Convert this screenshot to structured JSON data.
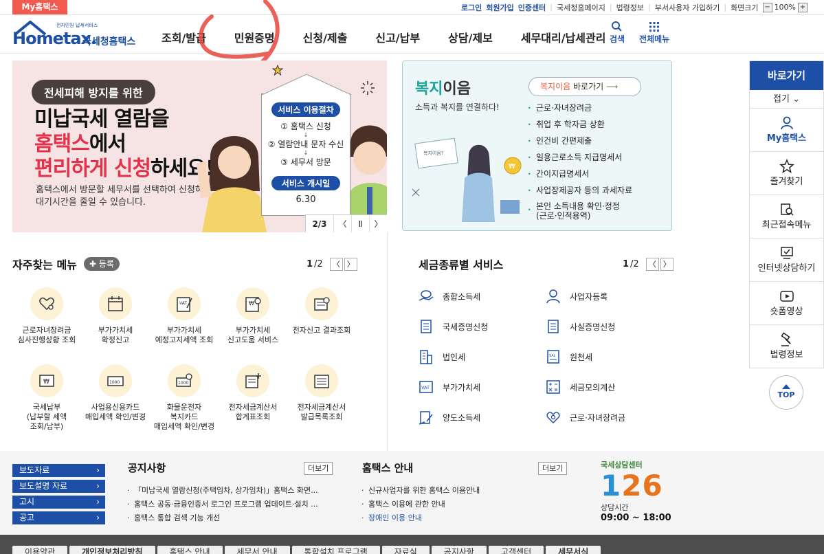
{
  "topbar": {
    "my_hometax": "My홈택스",
    "utils": [
      "로그인",
      "회원가입",
      "인증센터",
      "국세청홈페이지",
      "법령정보",
      "부서사용자 가입하기",
      "화면크기"
    ],
    "zoom": "100%"
  },
  "header": {
    "logo_word": "Hometax.",
    "logo_small": "전자민원 납세서비스",
    "logo_kr": "국세청홈택스",
    "nav": [
      "조회/발급",
      "민원증명",
      "신청/제출",
      "신고/납부",
      "상담/제보",
      "세무대리/납세관리"
    ],
    "search_label": "검색",
    "menu_label": "전체메뉴"
  },
  "hero": {
    "pill": "전세피해 방지를 위한",
    "line1": "미납국세 열람을",
    "line2_red": "홈택스",
    "line2_rest": "에서",
    "line3_red": "편리하게 신청",
    "line3_rest": "하세요!",
    "sub1": "홈택스에서 방문할 세무서를 선택하여 신청하면",
    "sub2": "대기시간을 줄일 수 있습니다.",
    "proc_title": "서비스 이용절차",
    "steps": [
      "① 홈택스 신청",
      "② 열람안내 문자 수신",
      "③ 세무서 방문"
    ],
    "start_title": "서비스 개시일",
    "start_date": "6.30",
    "pager": "2/3",
    "prev": "〈",
    "pause": "Ⅱ",
    "next": "〉"
  },
  "welfare": {
    "title_green": "복지",
    "title_rest": "이음",
    "subtitle": "소득과 복지를 연결하다!",
    "btn_orange": "복지이음",
    "btn_rest": " 바로가기",
    "items": [
      "근로·자녀장려금",
      "취업 후 학자금 상환",
      "인건비 간편제출",
      "일용근로소득 지급명세서",
      "간이지급명세서",
      "사업장제공자 등의 과세자료"
    ],
    "last_item_1": "본인 소득내용 확인·정정",
    "last_item_2": "(근로·인적용역)"
  },
  "favorites": {
    "title": "자주찾는 메뉴",
    "register": "✚ 등록",
    "page": "1",
    "pages": "/2",
    "items": [
      {
        "l1": "근로자녀장려금",
        "l2": "심사진행상황 조회",
        "l3": ""
      },
      {
        "l1": "부가가치세",
        "l2": "확정신고",
        "l3": ""
      },
      {
        "l1": "부가가치세",
        "l2": "예정고지세액 조회",
        "l3": ""
      },
      {
        "l1": "부가가치세",
        "l2": "신고도움 서비스",
        "l3": ""
      },
      {
        "l1": "전자신고 결과조회",
        "l2": "",
        "l3": ""
      },
      {
        "l1": "국세납부",
        "l2": "(납부할 세액",
        "l3": "조회/납부)"
      },
      {
        "l1": "사업용신용카드",
        "l2": "매입세액 확인/변경",
        "l3": ""
      },
      {
        "l1": "화물운전자",
        "l2": "복지카드",
        "l3": "매입세액 확인/변경"
      },
      {
        "l1": "전자세금계산서",
        "l2": "합계표조회",
        "l3": ""
      },
      {
        "l1": "전자세금계산서",
        "l2": "발급목록조회",
        "l3": ""
      }
    ]
  },
  "taxsvc": {
    "title": "세금종류별 서비스",
    "page": "1",
    "pages": "/2",
    "items": [
      "종합소득세",
      "사업자등록",
      "국세증명신청",
      "사실증명신청",
      "법인세",
      "원천세",
      "부가가치세",
      "세금모의계산",
      "양도소득세",
      "근로·자녀장려금"
    ]
  },
  "rail": {
    "head": "바로가기",
    "fold": "접기 ⌄",
    "items": [
      "My홈택스",
      "즐겨찾기",
      "최근접속메뉴",
      "인터넷상담하기",
      "숏폼영상",
      "법령정보"
    ],
    "top": "TOP"
  },
  "bottom": {
    "press": [
      "보도자료",
      "보도설명 자료",
      "고시",
      "공고"
    ],
    "notice_title": "공지사항",
    "more": "더보기",
    "notices": [
      "「미납국세 열람신청(주택임차, 상가임차)」홈택스 화면...",
      "홈택스 공동·금융인증서 로그인 프로그램 업데이트·설치 ...",
      "홈택스 통합 검색 기능 개선"
    ],
    "guide_title": "홈택스 안내",
    "guides": [
      "신규사업자를 위한 홈택스 이용안내",
      "홈택스 이용에 관한 안내",
      "장애인 이용 안내"
    ],
    "cs_title": "국세상담센터",
    "cs_num_a": "1",
    "cs_num_b": "26",
    "cs_hours_label": "상담시간",
    "cs_hours": "09:00 ~ 18:00"
  },
  "footer": {
    "tabs": [
      "이용약관",
      "개인정보처리방침",
      "홈택스 안내",
      "세무서 안내",
      "통합설치 프로그램",
      "자료실",
      "공지사항",
      "고객센터",
      "세무서식"
    ]
  },
  "colors": {
    "brand_blue": "#1e4fa6",
    "accent_red": "#f05a4f",
    "welfare_green": "#1ba39c",
    "annotation": "#e8453c"
  }
}
